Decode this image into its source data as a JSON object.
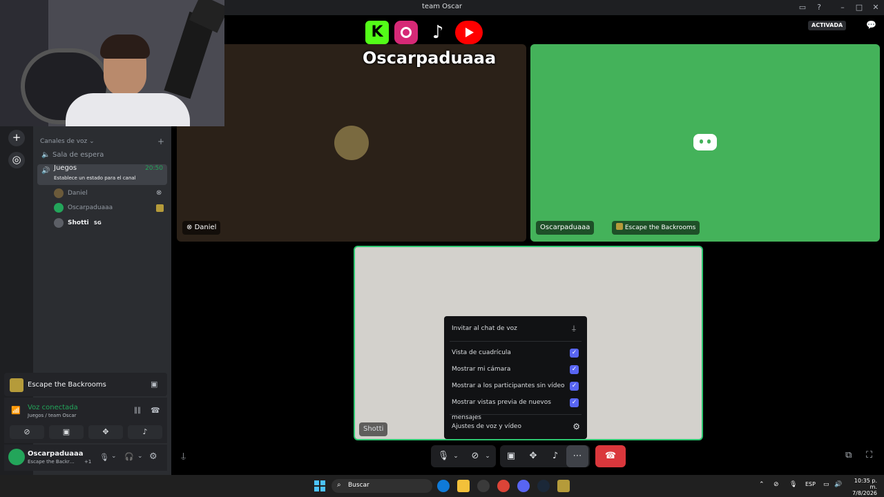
{
  "window": {
    "title": "team Oscar",
    "min": "–",
    "max": "□",
    "close": "✕"
  },
  "header": {
    "badge": "ACTIVADA"
  },
  "sidebar": {
    "section_title": "Canales de voz",
    "channels": [
      {
        "name": "Sala de espera"
      },
      {
        "name": "Juegos",
        "timer": "20:50",
        "status": "Establece un estado para el canal"
      }
    ],
    "members": [
      {
        "name": "Daniel"
      },
      {
        "name": "Oscarpaduaaa"
      },
      {
        "name": "Shotti",
        "tag": "SG"
      }
    ]
  },
  "activity": {
    "title": "Escape the Backrooms"
  },
  "voice": {
    "status": "Voz conectada",
    "location": "Juegos / team Oscar"
  },
  "user": {
    "name": "Oscarpaduaaa",
    "activity": "Escape the Backr…",
    "extra": "+1"
  },
  "tiles": {
    "daniel": "Daniel",
    "oscar": "Oscarpaduaaa",
    "oscar_activity": "Escape the Backrooms",
    "shotti": "Shotti"
  },
  "menu": {
    "invite": "Invitar al chat de voz",
    "grid": "Vista de cuadrícula",
    "camera": "Mostrar mi cámara",
    "non_video": "Mostrar a los participantes sin vídeo",
    "previews": "Mostrar vistas previa de nuevos mensajes",
    "av_settings": "Ajustes de voz y vídeo"
  },
  "banner": {
    "name": "Oscarpaduaaa"
  },
  "taskbar": {
    "search_placeholder": "Buscar",
    "lang": "ESP",
    "time": "10:35 p. m.",
    "date": "7/8/2026"
  },
  "colors": {
    "accent": "#5865f2",
    "green": "#23a55a",
    "red": "#da373c"
  }
}
